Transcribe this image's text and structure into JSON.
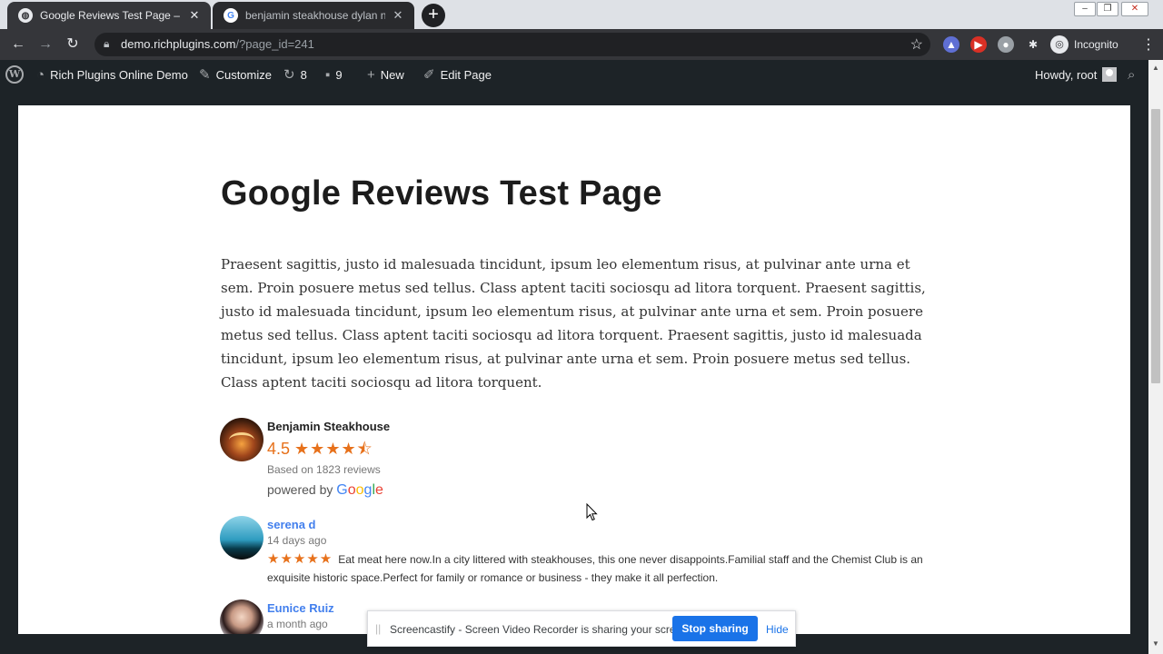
{
  "browser": {
    "tabs": [
      {
        "title": "Google Reviews Test Page – Rich",
        "active": true
      },
      {
        "title": "benjamin steakhouse dylan nyc -",
        "active": false
      }
    ],
    "new_tab_symbol": "+",
    "address": {
      "host": "demo.richplugins.com",
      "path": "/?page_id=241"
    },
    "profile_label": "Incognito",
    "icons": {
      "back": "arrow-left-icon",
      "forward": "arrow-right-icon",
      "reload": "reload-icon",
      "lock": "lock-icon",
      "star": "bookmark-star-icon",
      "extensions": "puzzle-icon",
      "menu": "kebab-menu-icon"
    }
  },
  "adminbar": {
    "site_name": "Rich Plugins Online Demo",
    "customize": "Customize",
    "updates_count": "8",
    "comments_count": "9",
    "new_label": "New",
    "edit_page": "Edit Page",
    "howdy": "Howdy, root"
  },
  "page": {
    "title": "Google Reviews Test Page",
    "paragraph": "Praesent sagittis, justo id malesuada tincidunt, ipsum leo elementum risus, at pulvinar ante urna et sem. Proin posuere metus sed tellus. Class aptent taciti sociosqu ad litora torquent. Praesent sagittis, justo id malesuada tincidunt, ipsum leo elementum risus, at pulvinar ante urna et sem. Proin posuere metus sed tellus. Class aptent taciti sociosqu ad litora torquent. Praesent sagittis, justo id malesuada tincidunt, ipsum leo elementum risus, at pulvinar ante urna et sem. Proin posuere metus sed tellus. Class aptent taciti sociosqu ad litora torquent."
  },
  "business": {
    "name": "Benjamin Steakhouse",
    "rating": "4.5",
    "stars": 4.5,
    "based_on": "Based on 1823 reviews",
    "powered_by": "powered by",
    "brand": "Google",
    "brand_colors": [
      "#4285f4",
      "#ea4335",
      "#fbbc05",
      "#4285f4",
      "#34a853",
      "#ea4335"
    ]
  },
  "reviews": [
    {
      "author": "serena d",
      "time": "14 days ago",
      "stars": 5,
      "text": "Eat meat here now.In a city littered with steakhouses, this one never disappoints.Familial staff and the Chemist Club is an exquisite historic space.Perfect for family or romance or business - they make it all perfection."
    },
    {
      "author": "Eunice Ruiz",
      "time": "a month ago"
    }
  ],
  "screencastify": {
    "message": "Screencastify - Screen Video Recorder is sharing your screen.",
    "stop_label": "Stop sharing",
    "hide_label": "Hide"
  },
  "colors": {
    "star": "#e7711b",
    "author_link": "#427fed",
    "adminbar_bg": "#1d2327",
    "stop_button": "#1a73e8"
  }
}
